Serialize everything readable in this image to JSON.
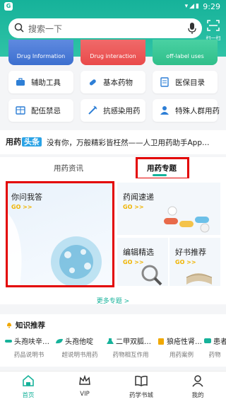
{
  "status": {
    "time": "9:29",
    "app_badge": "G",
    "icons": "▾◢▮"
  },
  "search": {
    "placeholder": "搜索一下",
    "scan_label": "扫一扫"
  },
  "cards": [
    {
      "label": "Drug Information"
    },
    {
      "label": "Drug interaction"
    },
    {
      "label": "off-label uses"
    }
  ],
  "tools": [
    {
      "label": "辅助工具"
    },
    {
      "label": "基本药物"
    },
    {
      "label": "医保目录"
    },
    {
      "label": "配伍禁忌"
    },
    {
      "label": "抗感染用药"
    },
    {
      "label": "特殊人群用药"
    }
  ],
  "news": {
    "logo_a": "用药",
    "logo_b": "头条",
    "text": "没有你，万般精彩皆枉然——人卫用药助手App…"
  },
  "tabs": {
    "t1": "用药资讯",
    "t2": "用药专题"
  },
  "topics": {
    "t1": {
      "title": "你问我答",
      "go": "GO >>"
    },
    "t2": {
      "title": "药闻速递",
      "go": "GO >>"
    },
    "t3": {
      "title": "编辑精选",
      "go": "GO >>"
    },
    "t4": {
      "title": "好书推荐",
      "go": "GO >>"
    }
  },
  "more_topics": "更多专题 >",
  "knowledge": {
    "heading": "知识推荐",
    "items": [
      {
        "title": "头孢呋辛…",
        "sub": "药品说明书"
      },
      {
        "title": "头孢他啶",
        "sub": "超说明书用药"
      },
      {
        "title": "二甲双胍…",
        "sub": "药物相互作用"
      },
      {
        "title": "狼疮性肾…",
        "sub": "用药案例"
      },
      {
        "title": "患者",
        "sub": "药物"
      }
    ]
  },
  "nav": [
    {
      "label": "首页"
    },
    {
      "label": "VIP"
    },
    {
      "label": "药学书城"
    },
    {
      "label": "我的"
    }
  ],
  "colors": {
    "brand": "#16b29a",
    "highlight_box": "#e30000",
    "go_text": "#f0b400"
  }
}
